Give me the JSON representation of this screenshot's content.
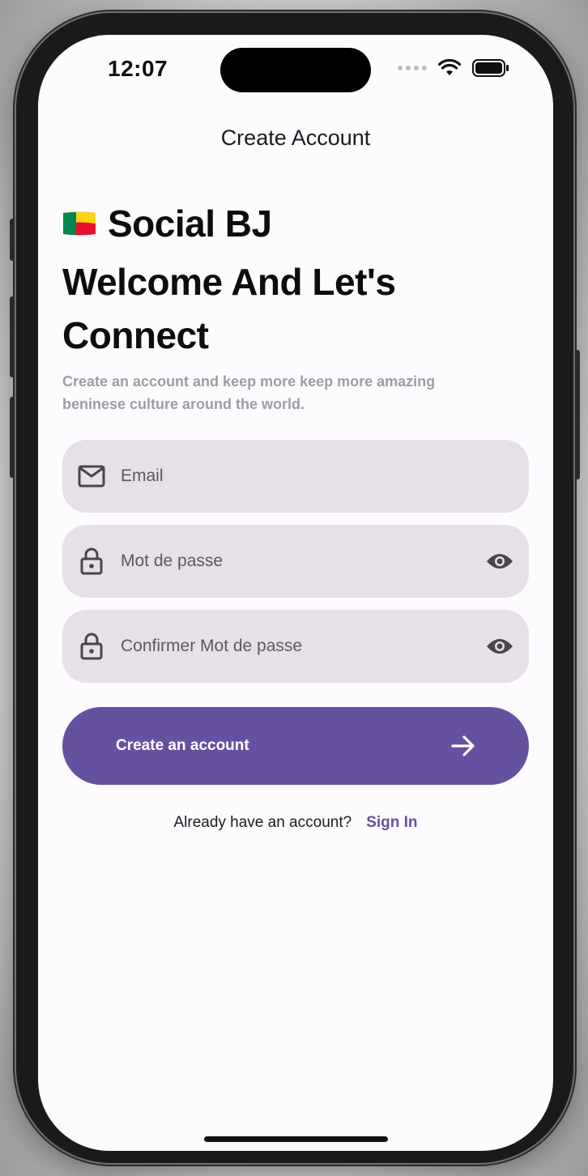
{
  "status_bar": {
    "time": "12:07",
    "icons": [
      "signal-dots-icon",
      "wifi-icon",
      "battery-icon"
    ]
  },
  "nav": {
    "title": "Create Account"
  },
  "brand": {
    "flag_icon": "benin-flag-icon",
    "name": "Social BJ"
  },
  "headline": "Welcome And Let's Connect",
  "subtitle": "Create an account and keep more keep more amazing beninese culture around the world.",
  "form": {
    "email": {
      "placeholder": "Email",
      "icon": "mail-icon"
    },
    "password": {
      "placeholder": "Mot de passe",
      "icon": "lock-icon",
      "toggle_icon": "eye-icon"
    },
    "confirm_password": {
      "placeholder": "Confirmer Mot de passe",
      "icon": "lock-icon",
      "toggle_icon": "eye-icon"
    }
  },
  "cta": {
    "label": "Create an account",
    "icon": "arrow-right-icon"
  },
  "footer": {
    "prompt": "Already have an account?",
    "link": "Sign In"
  },
  "colors": {
    "primary": "#6551a0",
    "field_bg": "#e6e1e9",
    "screen_bg": "#fdfbfe",
    "subtitle": "#a09ca4"
  }
}
